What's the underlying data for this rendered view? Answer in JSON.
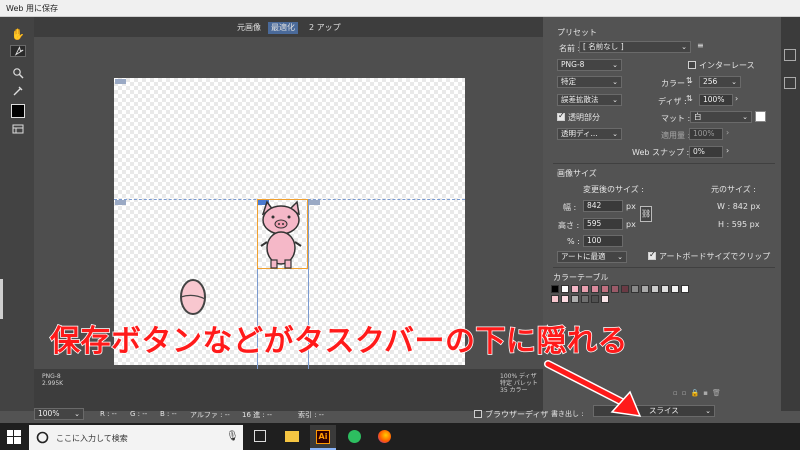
{
  "window": {
    "title": "Web 用に保存"
  },
  "view_tabs": [
    "元画像",
    "最適化",
    "2 アップ"
  ],
  "view_tabs_active": 1,
  "preview_info": {
    "left": [
      "PNG-8",
      "2.995K"
    ],
    "right": [
      "100% ディザ",
      "特定 パレット",
      "35 カラー"
    ]
  },
  "statusbar": {
    "zoom": "100%",
    "r": "R : --",
    "g": "G : --",
    "b": "B : --",
    "alpha": "アルファ : --",
    "hex": "16 進 : --",
    "index": "索引 : --"
  },
  "panel": {
    "preset_header": "プリセット",
    "name_label": "名前 :",
    "name_value": "[ 名前なし ]",
    "format": "PNG-8",
    "interlace": "インターレース",
    "reduction": "特定",
    "colors_label": "カラー :",
    "colors_value": "256",
    "dither_algo": "誤差拡散法",
    "dither_label": "ディザ :",
    "dither_value": "100%",
    "transparency": "透明部分",
    "matte_label": "マット :",
    "matte_value": "白",
    "trans_dither": "透明ディ...",
    "amount_label": "適用量 :",
    "amount_value": "100%",
    "websnap_label": "Web スナップ :",
    "websnap_value": "0%",
    "image_size_header": "画像サイズ",
    "new_size": "変更後のサイズ :",
    "orig_size": "元のサイズ :",
    "width_label": "幅 :",
    "width_value": "842",
    "height_label": "高さ :",
    "height_value": "595",
    "unit_px": "px",
    "percent_label": "% :",
    "percent_value": "100",
    "orig_w": "W : 842 px",
    "orig_h": "H : 595 px",
    "fit": "アートに最適",
    "clip": "アートボードサイズでクリップ",
    "color_table_header": "カラーテーブル",
    "export_label": "書き出し :",
    "export_value": "スライス"
  },
  "browser_dither": "ブラウザーディザ",
  "taskbar": {
    "search_placeholder": "ここに入力して検索",
    "apps": [
      "task-view",
      "file-explorer",
      "illustrator",
      "evernote",
      "firefox"
    ]
  },
  "annotation": "保存ボタンなどがタスクバーの下に隠れる",
  "colors": {
    "accent": "#4a6a9a",
    "annotation_red": "#ff1a1a",
    "pig_pink": "#f5b8c8",
    "egg_pink": "#f8c7cf",
    "illustrator_orange": "#ff9a00"
  }
}
